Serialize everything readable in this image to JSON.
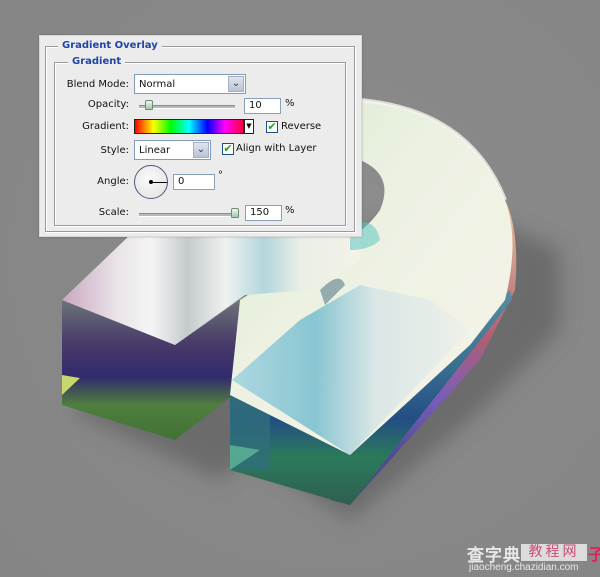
{
  "dialog": {
    "section_title": "Gradient Overlay",
    "group_title": "Gradient",
    "blend_mode": {
      "label": "Blend Mode:",
      "value": "Normal"
    },
    "opacity": {
      "label": "Opacity:",
      "value": "10",
      "unit": "%",
      "slider_fraction": 0.1
    },
    "gradient": {
      "label": "Gradient:",
      "stops": [
        "#ff0000",
        "#ffff00",
        "#00ff00",
        "#00ffff",
        "#0000ff",
        "#ff00ff",
        "#ff0040"
      ],
      "reverse_label": "Reverse",
      "reverse_checked": true
    },
    "style": {
      "label": "Style:",
      "value": "Linear",
      "align_label": "Align with Layer",
      "align_checked": true
    },
    "angle": {
      "label": "Angle:",
      "value": "0",
      "unit": "°"
    },
    "scale": {
      "label": "Scale:",
      "value": "150",
      "unit": "%",
      "slider_fraction": 1.0
    }
  },
  "icons": {
    "dropdown_arrow": "⌄",
    "small_arrow": "▼",
    "check": "✔"
  },
  "watermark": {
    "brand": "查字典",
    "section": "教程网",
    "suffix": "子",
    "url": "jiaocheng.chazidian.com"
  }
}
